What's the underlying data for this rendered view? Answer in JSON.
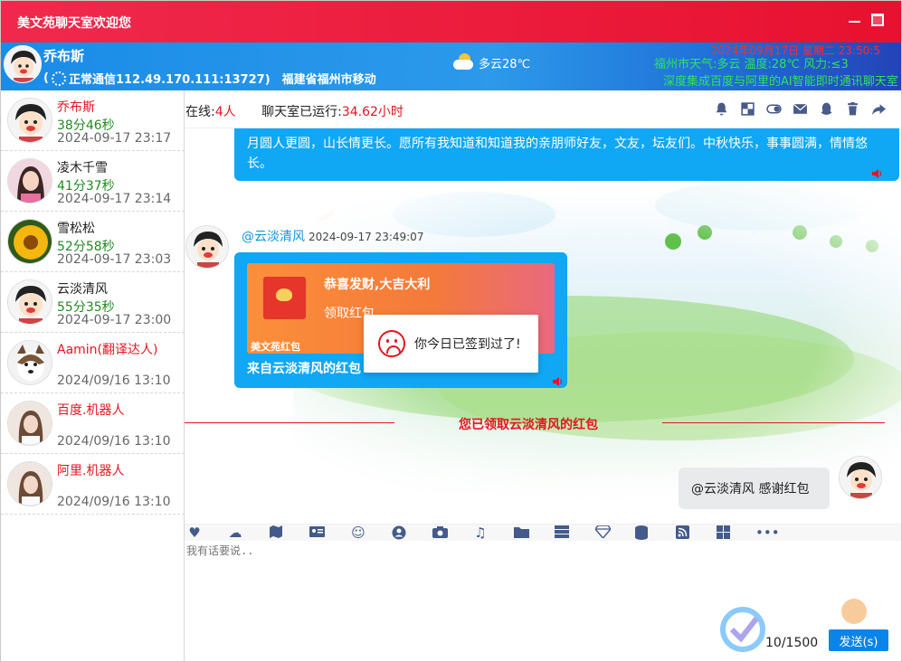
{
  "window": {
    "title": "美文苑聊天室欢迎您"
  },
  "header": {
    "username": "乔布斯",
    "connection": "正常通信112.49.170.111:13727)",
    "location": "福建省福州市移动",
    "weather": "多云28℃",
    "datetime": "2024年09月17日 星期二 23:50:5",
    "city_weather": "福州市天气:多云 温度:28℃ 风力:≤3",
    "marquee": "深度集成百度与阿里的AI智能即时通讯聊天室"
  },
  "sidebar": {
    "users": [
      {
        "name": "乔布斯",
        "duration": "38分46秒",
        "time": "2024-09-17 23:17",
        "red": true,
        "avatar": "cartoon-boy"
      },
      {
        "name": "凌木千雪",
        "duration": "41分37秒",
        "time": "2024-09-17 23:14",
        "red": false,
        "avatar": "girl-photo"
      },
      {
        "name": "雪松松",
        "duration": "52分58秒",
        "time": "2024-09-17 23:03",
        "red": false,
        "avatar": "sunflower"
      },
      {
        "name": "云淡清风",
        "duration": "55分35秒",
        "time": "2024-09-17 23:00",
        "red": false,
        "avatar": "cartoon-boy"
      },
      {
        "name": "Aamin(翻译达人)",
        "duration": "",
        "time": "2024/09/16 13:10",
        "red": true,
        "avatar": "husky-dog"
      },
      {
        "name": "百度.机器人",
        "duration": "",
        "time": "2024/09/16 13:10",
        "red": true,
        "avatar": "woman-photo"
      },
      {
        "name": "阿里.机器人",
        "duration": "",
        "time": "2024/09/16 13:10",
        "red": true,
        "avatar": "woman-photo"
      }
    ]
  },
  "chatbar": {
    "online_label": "在线:",
    "online_count": "4人",
    "uptime_label": "聊天室已运行:",
    "uptime_value": "34.62小时"
  },
  "messages": {
    "first_text": "月圆人更圆，山长情更长。愿所有我知道和知道我的亲朋师好友，文友，坛友们。中秋快乐，事事圆满，情情悠长。",
    "sender": "@云淡清风",
    "sender_time": "2024-09-17 23:49:07",
    "red_packet": {
      "title": "恭喜发财,大吉大利",
      "action": "领取红包",
      "brand": "美文苑红包",
      "from": "来自云淡清风的红包"
    },
    "toast": "你今日已签到过了!",
    "notice": "您已领取云淡清风的红包",
    "reply": "@云淡清风 感谢红包"
  },
  "composer": {
    "placeholder": "我有话要说..",
    "counter": "10/1500",
    "send_label": "发送(s)"
  },
  "colors": {
    "title_bar": "#e8112f",
    "accent_blue": "#10a7f5",
    "online_green": "#1f8a1f",
    "red": "#e4151f"
  }
}
